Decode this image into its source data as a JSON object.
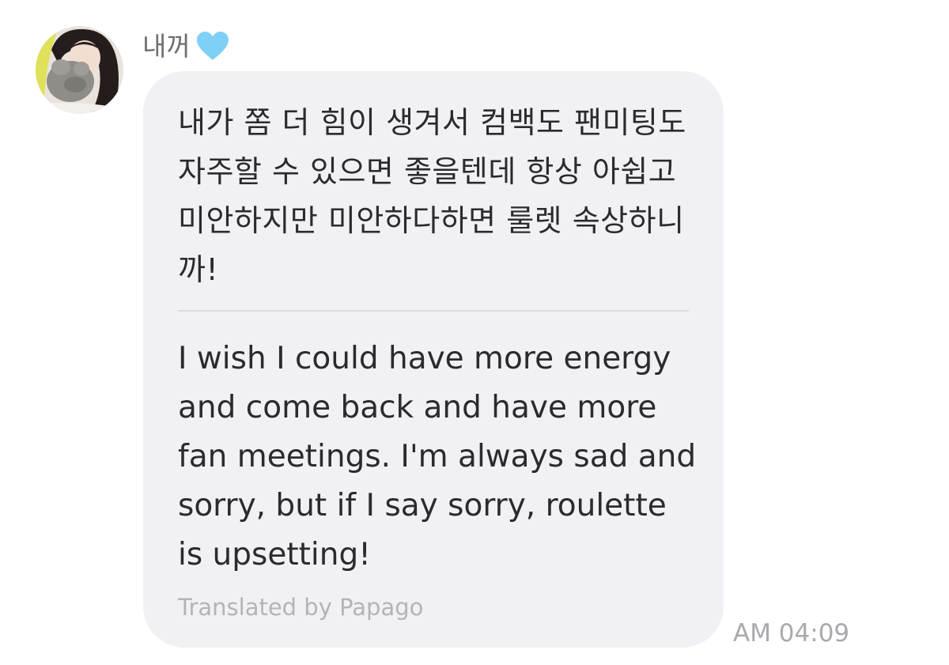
{
  "message": {
    "sender": {
      "name": "내꺼",
      "badge_icon": "blue-heart-icon",
      "badge_color": "#7fd0f7",
      "avatar": "profile-photo"
    },
    "original_text": "내가 쫌 더 힘이 생겨서 컴백도 팬미팅도 자주할 수 있으면 좋을텐데 항상 아쉽고 미안하지만 미안하다하면 룰렛 속상하니까!",
    "translated_text": "I wish I could have more energy and come back and have more fan meetings. I'm always sad and sorry, but if I say sorry, roulette is upsetting!",
    "translation_credit": "Translated by Papago",
    "timestamp": "AM 04:09",
    "bubble_color": "#f1f1f5"
  }
}
